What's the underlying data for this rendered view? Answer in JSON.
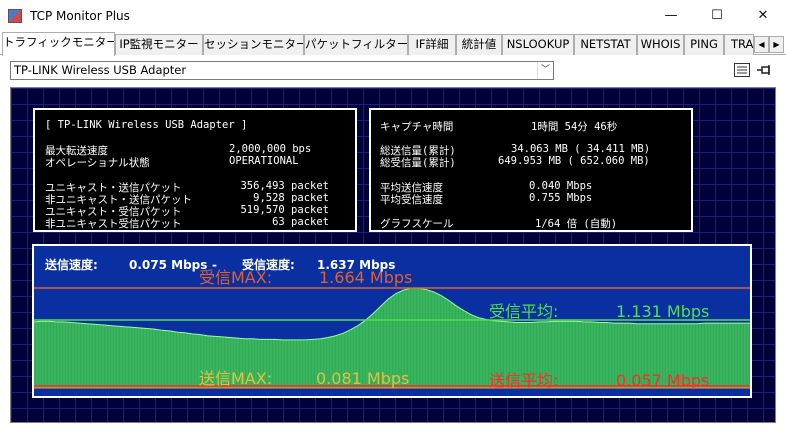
{
  "window": {
    "title": "TCP Monitor Plus",
    "minimize": "—",
    "maximize": "☐",
    "close": "✕"
  },
  "tabs": [
    {
      "label": "トラフィックモニター",
      "active": true
    },
    {
      "label": "IP監視モニター"
    },
    {
      "label": "セッションモニター"
    },
    {
      "label": "パケットフィルター"
    },
    {
      "label": "IF詳細"
    },
    {
      "label": "統計値"
    },
    {
      "label": "NSLOOKUP"
    },
    {
      "label": "NETSTAT"
    },
    {
      "label": "WHOIS"
    },
    {
      "label": "PING"
    },
    {
      "label": "TRA"
    }
  ],
  "tab_scroll": {
    "left": "◀",
    "right": "▶"
  },
  "adapter": {
    "selected": "TP-LINK Wireless USB Adapter",
    "arrow": "﹀"
  },
  "icons": {
    "list": "list-icon",
    "pin": "pin-icon"
  },
  "adapter_info": {
    "header": "[ TP-LINK Wireless USB Adapter ]",
    "rows": [
      {
        "label": "最大転送速度",
        "value": "2,000,000 bps"
      },
      {
        "label": "オペレーショナル状態",
        "value": "OPERATIONAL"
      },
      {
        "label": "ユニキャスト・送信パケット",
        "value": "356,493 packet"
      },
      {
        "label": "非ユニキャスト・送信パケット",
        "value": "9,528 packet"
      },
      {
        "label": "ユニキャスト・受信パケット",
        "value": "519,570 packet"
      },
      {
        "label": "非ユニキャスト受信パケット",
        "value": "63 packet"
      }
    ]
  },
  "capture_info": {
    "rows": [
      {
        "label": "キャプチャ時間",
        "value": "1時間 54分 46秒"
      },
      {
        "label": "総送信量(累計)",
        "value": "34.063 MB ( 34.411 MB)"
      },
      {
        "label": "総受信量(累計)",
        "value": "649.953 MB ( 652.060 MB)"
      },
      {
        "label": "平均送信速度",
        "value": "0.040 Mbps"
      },
      {
        "label": "平均受信速度",
        "value": "0.755 Mbps"
      },
      {
        "label": "グラフスケール",
        "value": "1/64 倍 (自動)"
      }
    ]
  },
  "graph": {
    "send_speed_label": "送信速度:",
    "send_speed_value": "0.075 Mbps",
    "separator": "-",
    "recv_speed_label": "受信速度:",
    "recv_speed_value": "1.637 Mbps",
    "recv_max_label": "受信MAX:",
    "recv_max_value": "1.664 Mbps",
    "recv_avg_label": "受信平均:",
    "recv_avg_value": "1.131 Mbps",
    "send_max_label": "送信MAX:",
    "send_max_value": "0.081 Mbps",
    "send_avg_label": "送信平均:",
    "send_avg_value": "0.057 Mbps",
    "colors": {
      "background": "#0a2fa0",
      "fill": "#2faa55",
      "line": "#9aff9a",
      "recv_max": "#e06030",
      "recv_avg": "#50e050",
      "send_max": "#e0c040",
      "send_avg": "#ff2a2a"
    },
    "recv_scale_max_mbps": 1.664,
    "recv_avg_mbps": 1.131,
    "recv_samples_mbps": [
      1.1,
      1.11,
      1.11,
      1.1,
      1.1,
      1.09,
      1.08,
      1.07,
      1.06,
      1.05,
      1.04,
      1.03,
      1.02,
      1.01,
      1.0,
      0.99,
      0.98,
      0.96,
      0.95,
      0.93,
      0.92,
      0.9,
      0.89,
      0.87,
      0.86,
      0.85,
      0.84,
      0.83,
      0.82,
      0.82,
      0.81,
      0.81,
      0.81,
      0.8,
      0.8,
      0.8,
      0.8,
      0.81,
      0.82,
      0.84,
      0.87,
      0.91,
      0.97,
      1.04,
      1.13,
      1.24,
      1.36,
      1.48,
      1.57,
      1.63,
      1.66,
      1.66,
      1.64,
      1.6,
      1.54,
      1.46,
      1.37,
      1.29,
      1.22,
      1.17,
      1.14,
      1.12,
      1.11,
      1.1,
      1.09,
      1.09,
      1.09,
      1.1,
      1.1,
      1.11,
      1.11,
      1.11,
      1.11,
      1.1,
      1.1,
      1.09,
      1.09,
      1.08,
      1.08,
      1.08,
      1.07,
      1.07,
      1.07,
      1.07,
      1.07,
      1.07,
      1.07,
      1.07,
      1.07,
      1.08,
      1.08,
      1.08,
      1.08,
      1.08,
      1.08,
      1.08
    ]
  }
}
